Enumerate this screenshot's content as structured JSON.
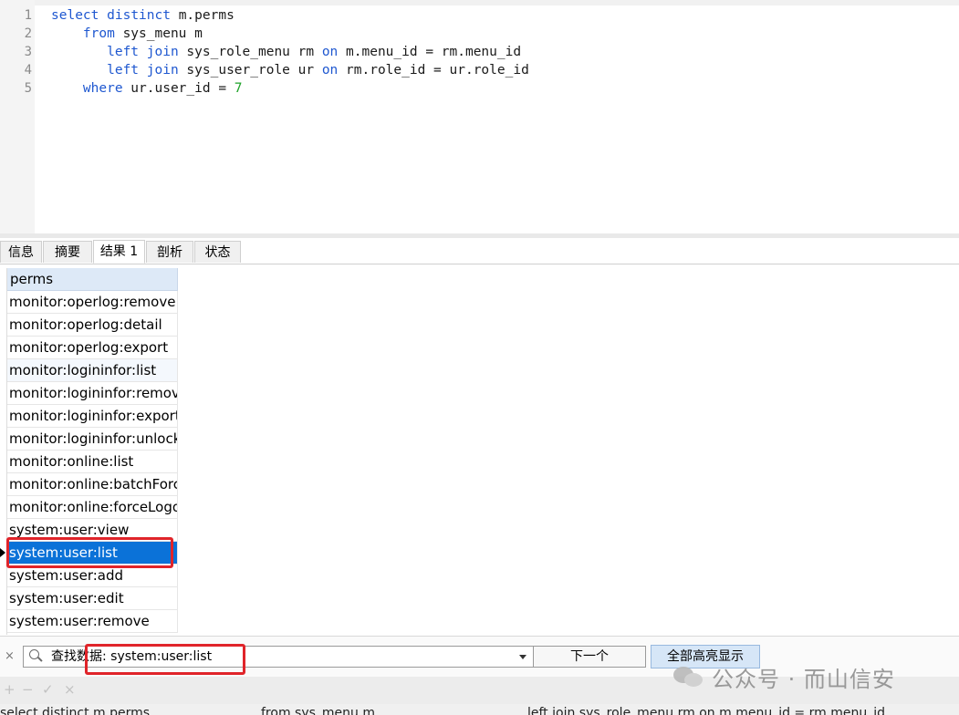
{
  "editor": {
    "line_numbers": [
      "1",
      "2",
      "3",
      "4",
      "5"
    ],
    "lines": [
      [
        {
          "t": "select",
          "k": "kw"
        },
        {
          "t": " "
        },
        {
          "t": "distinct",
          "k": "kw"
        },
        {
          "t": " m.perms"
        }
      ],
      [
        {
          "t": "    "
        },
        {
          "t": "from",
          "k": "kw"
        },
        {
          "t": " sys_menu m"
        }
      ],
      [
        {
          "t": "       "
        },
        {
          "t": "left",
          "k": "kw"
        },
        {
          "t": " "
        },
        {
          "t": "join",
          "k": "kw"
        },
        {
          "t": " sys_role_menu rm "
        },
        {
          "t": "on",
          "k": "kw"
        },
        {
          "t": " m.menu_id = rm.menu_id"
        }
      ],
      [
        {
          "t": "       "
        },
        {
          "t": "left",
          "k": "kw"
        },
        {
          "t": " "
        },
        {
          "t": "join",
          "k": "kw"
        },
        {
          "t": " sys_user_role ur "
        },
        {
          "t": "on",
          "k": "kw"
        },
        {
          "t": " rm.role_id = ur.role_id"
        }
      ],
      [
        {
          "t": "    "
        },
        {
          "t": "where",
          "k": "kw"
        },
        {
          "t": " ur.user_id = "
        },
        {
          "t": "7",
          "k": "num"
        }
      ]
    ]
  },
  "tabs": [
    "信息",
    "摘要",
    "结果 1",
    "剖析",
    "状态"
  ],
  "active_tab": "结果 1",
  "grid": {
    "column": "perms",
    "rows": [
      "monitor:operlog:remove",
      "monitor:operlog:detail",
      "monitor:operlog:export",
      "monitor:logininfor:list",
      "monitor:logininfor:remove",
      "monitor:logininfor:export",
      "monitor:logininfor:unlock",
      "monitor:online:list",
      "monitor:online:batchForceLogout",
      "monitor:online:forceLogout",
      "system:user:view",
      "system:user:list",
      "system:user:add",
      "system:user:edit",
      "system:user:remove"
    ],
    "selected_row": "system:user:list"
  },
  "find": {
    "close_label": "×",
    "label": "查找数据: system:user:list",
    "next_button": "下一个",
    "highlight_all_button": "全部高亮显示"
  },
  "toolbar": {
    "add": "+",
    "remove": "−",
    "apply": "✓",
    "cancel": "×"
  },
  "status": {
    "seg1": "select distinct m.perms",
    "seg2": "from sys_menu m",
    "seg3": "left join sys_role_menu rm on m.menu_id = rm.menu_id"
  },
  "watermark": "公众号 · 而山信安",
  "colors": {
    "keyword": "#1f58d0",
    "number": "#1fa32a",
    "selection": "#0b72d8",
    "annotation": "#e0242a"
  }
}
